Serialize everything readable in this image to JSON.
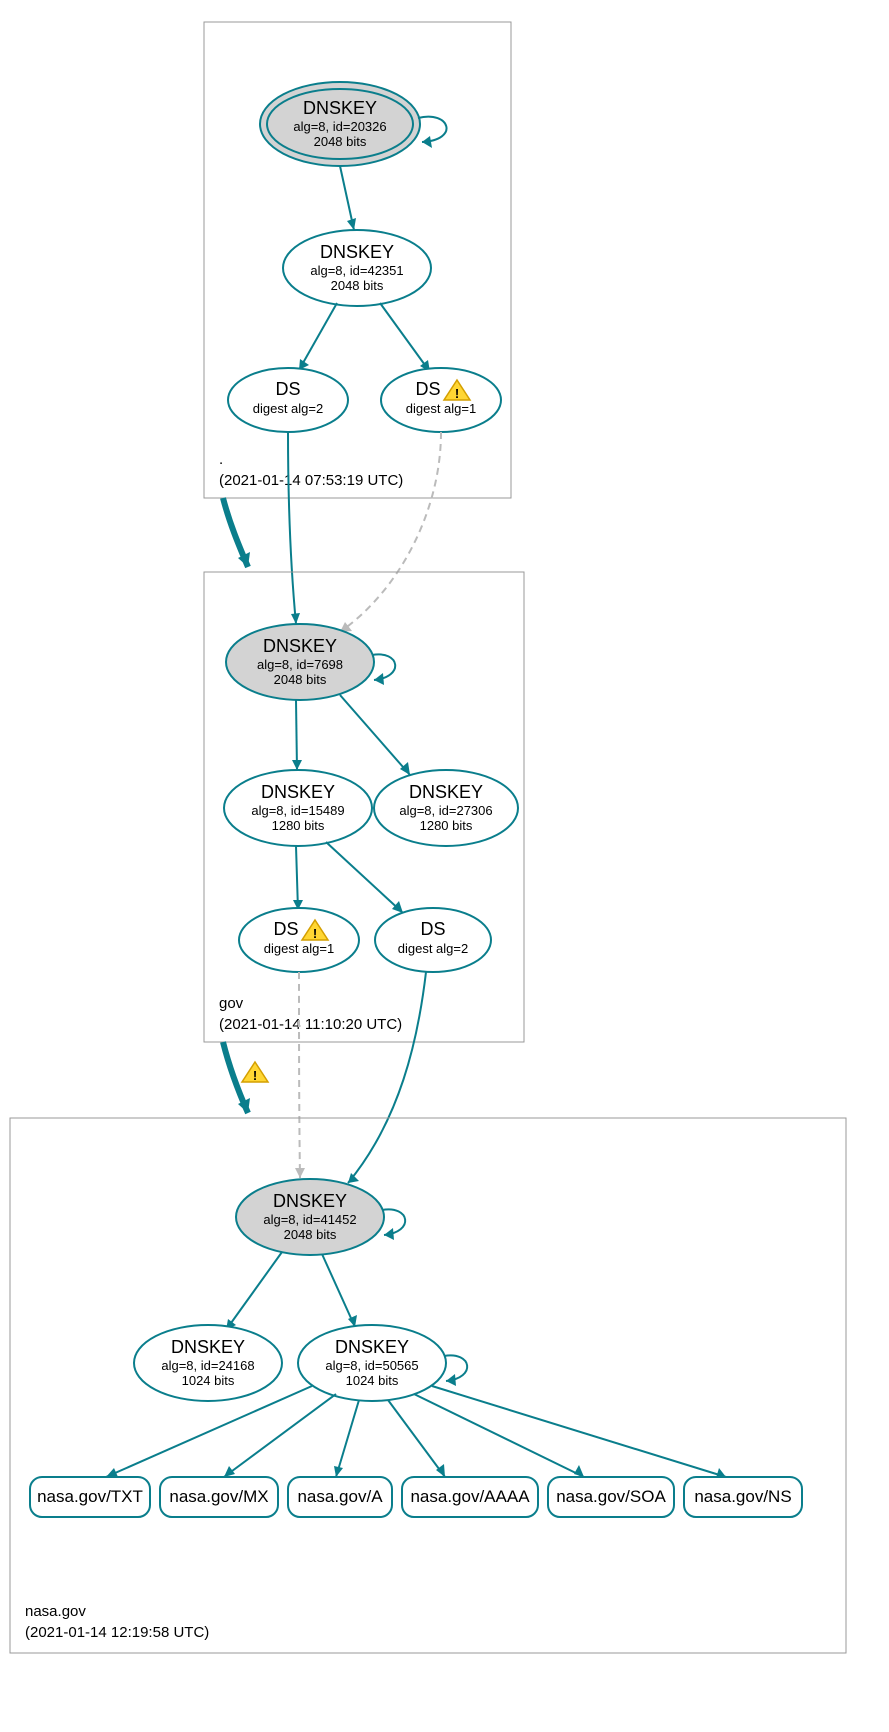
{
  "zones": {
    "root": {
      "label": ".",
      "time": "(2021-01-14 07:53:19 UTC)"
    },
    "gov": {
      "label": "gov",
      "time": "(2021-01-14 11:10:20 UTC)"
    },
    "nasa": {
      "label": "nasa.gov",
      "time": "(2021-01-14 12:19:58 UTC)"
    }
  },
  "nodes": {
    "root_k1": {
      "title": "DNSKEY",
      "l1": "alg=8, id=20326",
      "l2": "2048 bits"
    },
    "root_k2": {
      "title": "DNSKEY",
      "l1": "alg=8, id=42351",
      "l2": "2048 bits"
    },
    "root_ds1": {
      "title": "DS",
      "l1": "digest alg=2"
    },
    "root_ds2": {
      "title": "DS",
      "l1": "digest alg=1"
    },
    "gov_k1": {
      "title": "DNSKEY",
      "l1": "alg=8, id=7698",
      "l2": "2048 bits"
    },
    "gov_k2": {
      "title": "DNSKEY",
      "l1": "alg=8, id=15489",
      "l2": "1280 bits"
    },
    "gov_k3": {
      "title": "DNSKEY",
      "l1": "alg=8, id=27306",
      "l2": "1280 bits"
    },
    "gov_ds1": {
      "title": "DS",
      "l1": "digest alg=1"
    },
    "gov_ds2": {
      "title": "DS",
      "l1": "digest alg=2"
    },
    "nasa_k1": {
      "title": "DNSKEY",
      "l1": "alg=8, id=41452",
      "l2": "2048 bits"
    },
    "nasa_k2": {
      "title": "DNSKEY",
      "l1": "alg=8, id=24168",
      "l2": "1024 bits"
    },
    "nasa_k3": {
      "title": "DNSKEY",
      "l1": "alg=8, id=50565",
      "l2": "1024 bits"
    }
  },
  "records": {
    "r1": "nasa.gov/TXT",
    "r2": "nasa.gov/MX",
    "r3": "nasa.gov/A",
    "r4": "nasa.gov/AAAA",
    "r5": "nasa.gov/SOA",
    "r6": "nasa.gov/NS"
  }
}
